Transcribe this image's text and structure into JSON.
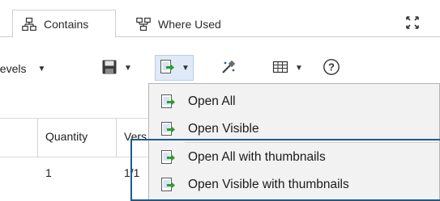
{
  "tabs": [
    {
      "label": "Contains",
      "icon": "contains-hierarchy-icon",
      "active": true
    },
    {
      "label": "Where Used",
      "icon": "where-used-hierarchy-icon",
      "active": false
    }
  ],
  "toolbar": {
    "levels_label": "Levels",
    "save_icon": "save-icon",
    "open_icon": "open-document-icon",
    "tools_icon": "tools-wand-icon",
    "table_icon": "table-view-icon",
    "help_icon": "help-icon",
    "help_glyph": "?"
  },
  "grid": {
    "columns": [
      "Quantity",
      "Vers"
    ],
    "rows": [
      [
        "1",
        "1/1"
      ]
    ]
  },
  "menu": {
    "items": [
      {
        "label": "Open All",
        "icon": "open-document-icon"
      },
      {
        "label": "Open Visible",
        "icon": "open-document-icon"
      },
      {
        "label": "Open All with thumbnails",
        "icon": "open-document-icon"
      },
      {
        "label": "Open Visible with thumbnails",
        "icon": "open-document-icon"
      }
    ]
  },
  "colors": {
    "accent": "#1f5a8b",
    "icon_green": "#2e9b2e",
    "icon_blue": "#2f5fa7"
  }
}
